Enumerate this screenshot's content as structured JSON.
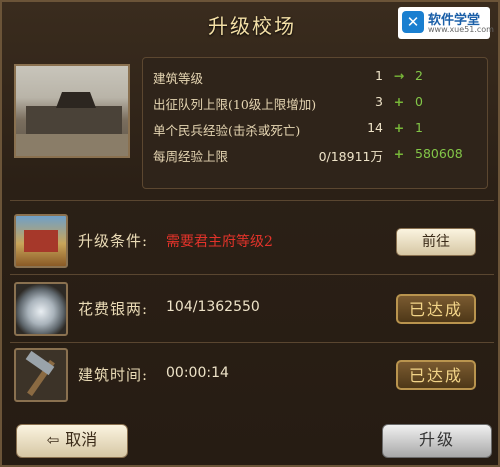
{
  "dialog": {
    "title": "升级校场"
  },
  "watermark": {
    "name": "软件学堂",
    "url": "www.xue51.com",
    "logo_glyph": "✕"
  },
  "building": {
    "image_icon": "training-ground-building-picture"
  },
  "stats": [
    {
      "label": "建筑等级",
      "current": "1",
      "op": "→",
      "next": "2"
    },
    {
      "label": "出征队列上限(10级上限增加)",
      "current": "3",
      "op": "+",
      "next": "0"
    },
    {
      "label": "单个民兵经验(击杀或死亡)",
      "current": "14",
      "op": "+",
      "next": "1"
    },
    {
      "label": "每周经验上限",
      "current": "0/18911万",
      "op": "+",
      "next": "580608"
    }
  ],
  "conditions": [
    {
      "icon": "palace-icon",
      "label": "升级条件:",
      "value": "需要君主府等级2",
      "button": "前往"
    },
    {
      "icon": "silver-ingot-icon",
      "label": "花费银两:",
      "value": "104/1362550",
      "button": "已达成"
    },
    {
      "icon": "hammer-icon",
      "label": "建筑时间:",
      "value": "00:00:14",
      "button": "已达成"
    }
  ],
  "footer": {
    "cancel_label": "取消",
    "cancel_icon": "back-arrow-icon",
    "upgrade_label": "升级"
  },
  "colors": {
    "requirement_red": "#e2332a",
    "increase_green": "#83c648",
    "title_gold": "#f3dfa6"
  }
}
